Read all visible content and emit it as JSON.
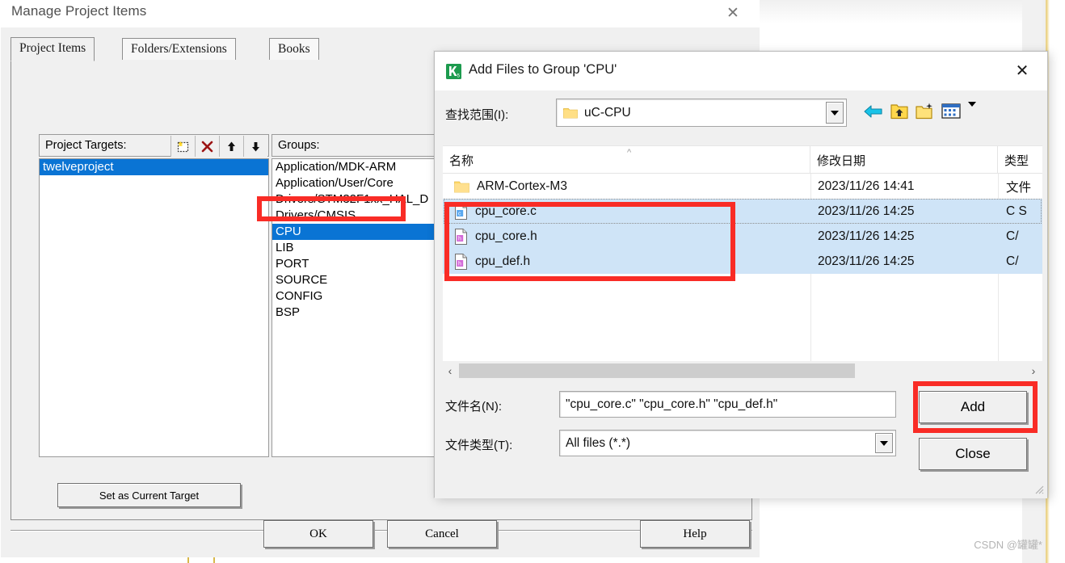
{
  "manage_dialog": {
    "title": "Manage Project Items",
    "close_icon": "close-icon",
    "tabs": [
      {
        "label": "Project Items",
        "active": true
      },
      {
        "label": "Folders/Extensions",
        "active": false
      },
      {
        "label": "Books",
        "active": false
      }
    ],
    "project_targets": {
      "header": "Project Targets:",
      "toolbar": [
        "new-item-icon",
        "delete-icon",
        "move-up-icon",
        "move-down-icon"
      ],
      "items": [
        {
          "label": "twelveproject",
          "selected": true
        }
      ]
    },
    "groups": {
      "header": "Groups:",
      "toolbar": [
        "new-item-icon",
        "delete-icon"
      ],
      "items": [
        {
          "label": "Application/MDK-ARM",
          "selected": false
        },
        {
          "label": "Application/User/Core",
          "selected": false
        },
        {
          "label": "Drivers/STM32F1xx_HAL_D",
          "selected": false
        },
        {
          "label": "Drivers/CMSIS",
          "selected": false
        },
        {
          "label": "CPU",
          "selected": true
        },
        {
          "label": "LIB",
          "selected": false
        },
        {
          "label": "PORT",
          "selected": false
        },
        {
          "label": "SOURCE",
          "selected": false
        },
        {
          "label": "CONFIG",
          "selected": false
        },
        {
          "label": "BSP",
          "selected": false
        }
      ]
    },
    "set_current_target_button": "Set as Current Target",
    "footer_buttons": [
      {
        "label": "OK"
      },
      {
        "label": "Cancel"
      },
      {
        "label": "Help"
      }
    ]
  },
  "add_files_dialog": {
    "title": "Add Files to Group 'CPU'",
    "app_icon": "keil-uvision-icon",
    "close_icon": "close-icon",
    "lookin": {
      "label": "查找范围(I):",
      "value": "uC-CPU",
      "folder_icon": "folder-icon",
      "dropdown_icon": "chevron-down-icon"
    },
    "nav_icons": [
      "back-arrow-icon",
      "up-one-level-icon",
      "new-folder-icon",
      "view-mode-icon"
    ],
    "file_list": {
      "columns": [
        "名称",
        "修改日期",
        "类型"
      ],
      "sort_indicator": "sort-ascending-caret",
      "rows": [
        {
          "icon": "folder-icon",
          "name": "ARM-Cortex-M3",
          "date": "2023/11/26 14:41",
          "type": "文件",
          "selected": false,
          "focused": false
        },
        {
          "icon": "c-file-icon",
          "name": "cpu_core.c",
          "date": "2023/11/26 14:25",
          "type": "C S",
          "selected": true,
          "focused": true
        },
        {
          "icon": "h-file-icon",
          "name": "cpu_core.h",
          "date": "2023/11/26 14:25",
          "type": "C/",
          "selected": true,
          "focused": false
        },
        {
          "icon": "h-file-icon",
          "name": "cpu_def.h",
          "date": "2023/11/26 14:25",
          "type": "C/",
          "selected": true,
          "focused": false
        }
      ]
    },
    "scroll": {
      "left_arrow": "‹",
      "right_arrow": "›"
    },
    "filename": {
      "label": "文件名(N):",
      "value": "\"cpu_core.c\" \"cpu_core.h\" \"cpu_def.h\"",
      "placeholder": ""
    },
    "filetype": {
      "label": "文件类型(T):",
      "value": "All files (*.*)",
      "dropdown_icon": "chevron-down-icon"
    },
    "add_button": "Add",
    "close_button": "Close"
  },
  "annotations": {
    "color": "#f92c26",
    "boxes": [
      {
        "name": "cpu-group-highlight"
      },
      {
        "name": "selected-files-highlight"
      },
      {
        "name": "add-button-highlight"
      }
    ]
  },
  "watermark": {
    "text": "CSDN @罐罐*"
  }
}
